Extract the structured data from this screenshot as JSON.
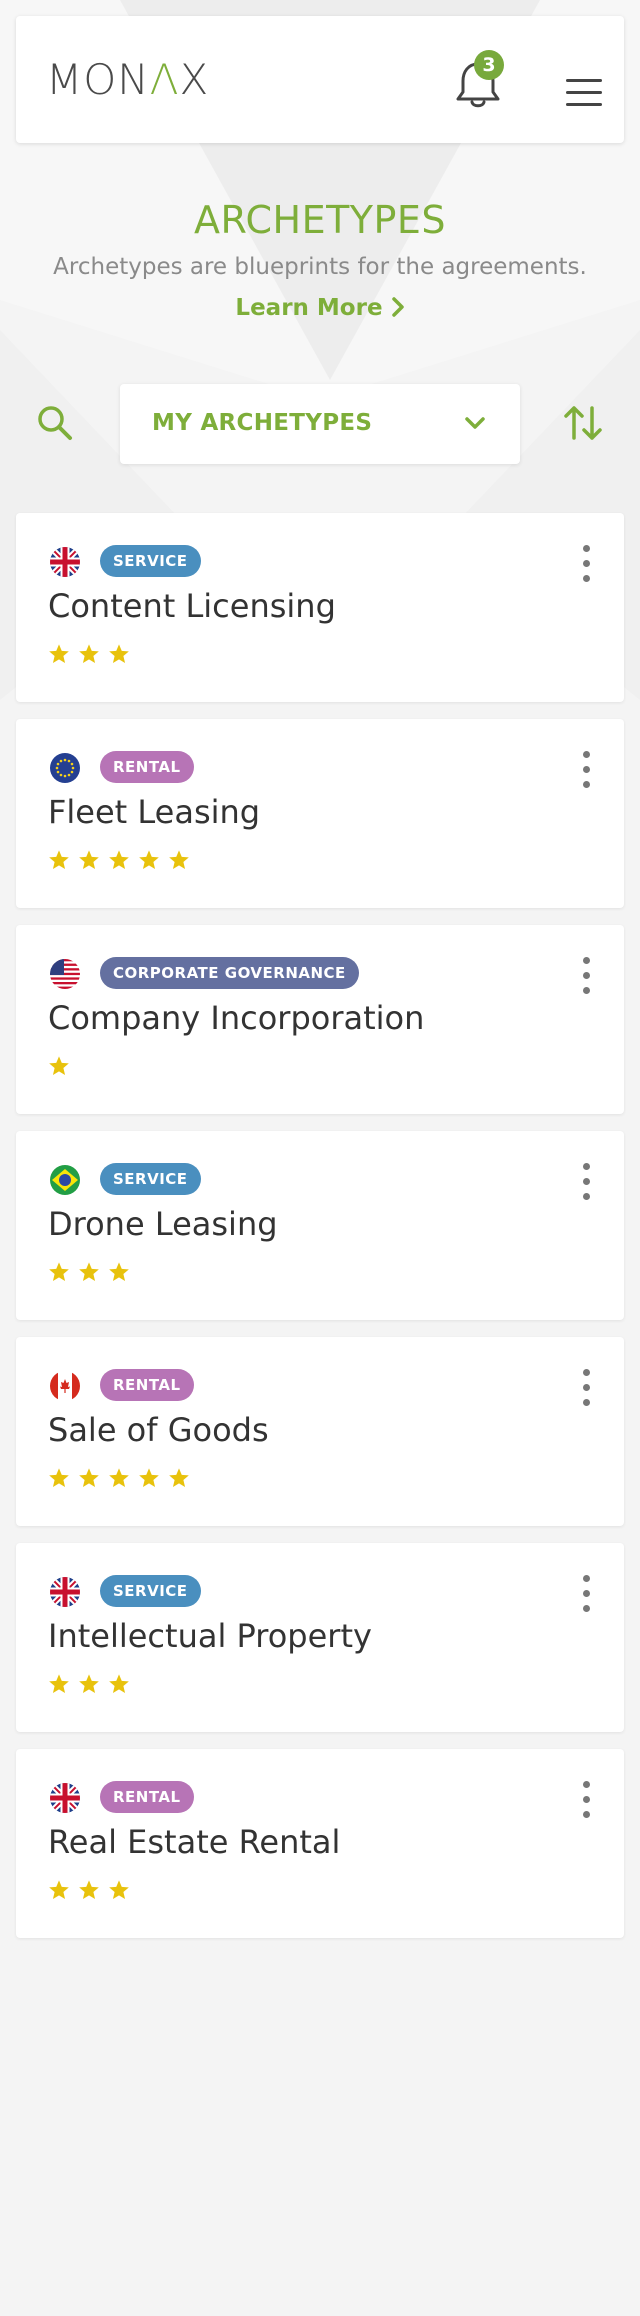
{
  "header": {
    "logo_text_1": "MON",
    "logo_text_2": "Λ",
    "logo_text_3": "X",
    "notification_count": "3"
  },
  "page": {
    "title": "ARCHETYPES",
    "subtitle": "Archetypes are blueprints for the agreements.",
    "learn_more": "Learn More"
  },
  "filter": {
    "selected": "MY ARCHETYPES"
  },
  "colors": {
    "brand_green": "#7eae3a",
    "service": "#4a8fbf",
    "rental": "#b774b6",
    "corporate": "#6470a0",
    "star": "#e8c20c"
  },
  "archetypes": [
    {
      "country": "uk-flag",
      "category": "SERVICE",
      "title": "Content Licensing",
      "rating": 3
    },
    {
      "country": "eu-flag",
      "category": "RENTAL",
      "title": "Fleet Leasing",
      "rating": 5
    },
    {
      "country": "us-flag",
      "category": "CORPORATE GOVERNANCE",
      "title": "Company Incorporation",
      "rating": 1
    },
    {
      "country": "brazil-flag",
      "category": "SERVICE",
      "title": "Drone Leasing",
      "rating": 3
    },
    {
      "country": "canada-flag",
      "category": "RENTAL",
      "title": "Sale of Goods",
      "rating": 5
    },
    {
      "country": "uk-flag",
      "category": "SERVICE",
      "title": "Intellectual Property",
      "rating": 3
    },
    {
      "country": "uk-flag",
      "category": "RENTAL",
      "title": "Real Estate Rental",
      "rating": 3
    }
  ]
}
